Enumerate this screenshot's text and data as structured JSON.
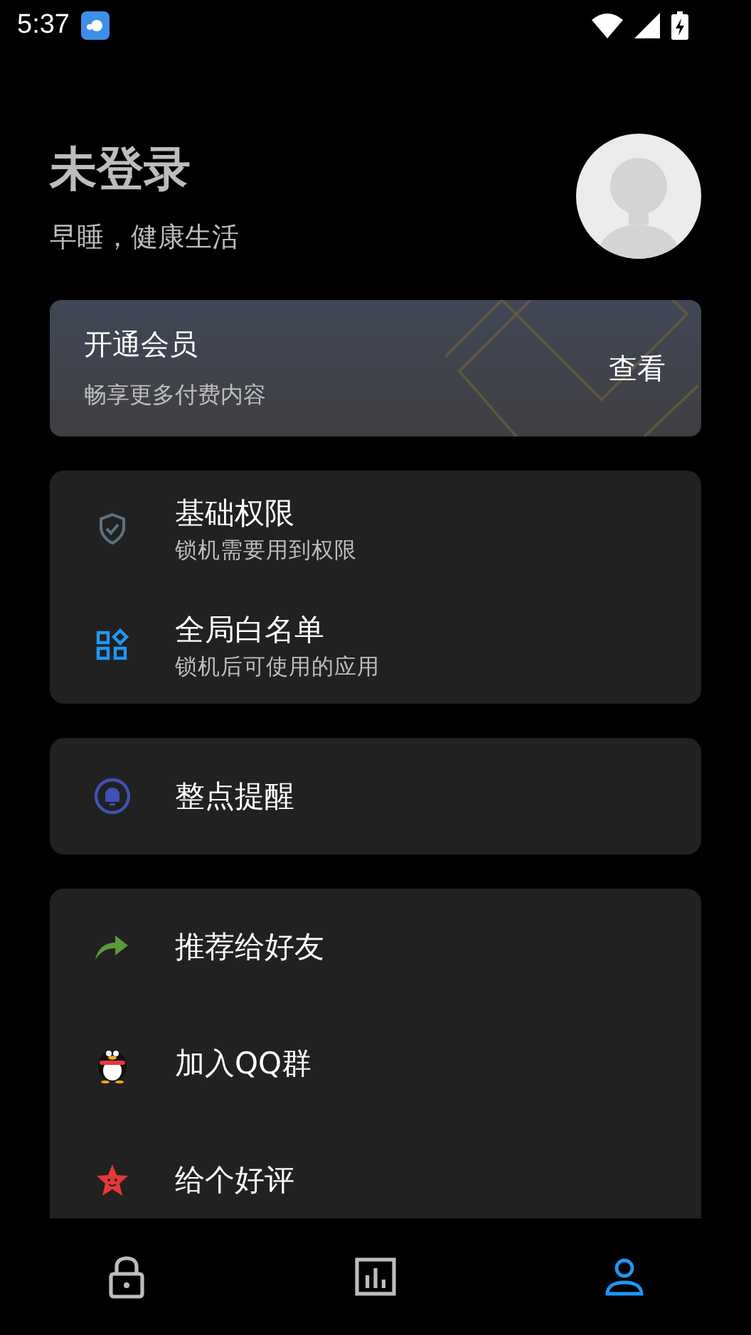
{
  "status_bar": {
    "time": "5:37"
  },
  "profile": {
    "name": "未登录",
    "slogan": "早睡，健康生活"
  },
  "vip_card": {
    "title": "开通会员",
    "subtitle": "畅享更多付费内容",
    "action": "查看"
  },
  "groups": [
    {
      "items": [
        {
          "kind": "shield",
          "title": "基础权限",
          "subtitle": "锁机需要用到权限"
        },
        {
          "kind": "grid",
          "title": "全局白名单",
          "subtitle": "锁机后可使用的应用"
        }
      ]
    },
    {
      "items": [
        {
          "kind": "bell",
          "title": "整点提醒"
        }
      ]
    },
    {
      "items": [
        {
          "kind": "share",
          "title": "推荐给好友"
        },
        {
          "kind": "penguin",
          "title": "加入QQ群"
        },
        {
          "kind": "star",
          "title": "给个好评"
        }
      ]
    }
  ],
  "bottom_nav": [
    {
      "kind": "lock",
      "selected": false
    },
    {
      "kind": "chart",
      "selected": false
    },
    {
      "kind": "person",
      "selected": true
    }
  ]
}
